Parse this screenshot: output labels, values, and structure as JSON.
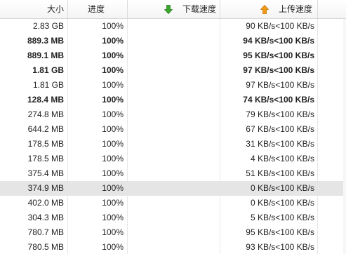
{
  "columns": {
    "size": "大小",
    "progress": "进度",
    "download_speed": "下载速度",
    "upload_speed": "上传速度"
  },
  "rows": [
    {
      "size": "2.83 GB",
      "progress": "100%",
      "down": "",
      "up": "90 KB/s<100 KB/s",
      "bold": false,
      "selected": false
    },
    {
      "size": "889.3 MB",
      "progress": "100%",
      "down": "",
      "up": "94 KB/s<100 KB/s",
      "bold": true,
      "selected": false
    },
    {
      "size": "889.1 MB",
      "progress": "100%",
      "down": "",
      "up": "95 KB/s<100 KB/s",
      "bold": true,
      "selected": false
    },
    {
      "size": "1.81 GB",
      "progress": "100%",
      "down": "",
      "up": "97 KB/s<100 KB/s",
      "bold": true,
      "selected": false
    },
    {
      "size": "1.81 GB",
      "progress": "100%",
      "down": "",
      "up": "97 KB/s<100 KB/s",
      "bold": false,
      "selected": false
    },
    {
      "size": "128.4 MB",
      "progress": "100%",
      "down": "",
      "up": "74 KB/s<100 KB/s",
      "bold": true,
      "selected": false
    },
    {
      "size": "274.8 MB",
      "progress": "100%",
      "down": "",
      "up": "79 KB/s<100 KB/s",
      "bold": false,
      "selected": false
    },
    {
      "size": "644.2 MB",
      "progress": "100%",
      "down": "",
      "up": "67 KB/s<100 KB/s",
      "bold": false,
      "selected": false
    },
    {
      "size": "178.5 MB",
      "progress": "100%",
      "down": "",
      "up": "31 KB/s<100 KB/s",
      "bold": false,
      "selected": false
    },
    {
      "size": "178.5 MB",
      "progress": "100%",
      "down": "",
      "up": "4 KB/s<100 KB/s",
      "bold": false,
      "selected": false
    },
    {
      "size": "375.4 MB",
      "progress": "100%",
      "down": "",
      "up": "51 KB/s<100 KB/s",
      "bold": false,
      "selected": false
    },
    {
      "size": "374.9 MB",
      "progress": "100%",
      "down": "",
      "up": "0 KB/s<100 KB/s",
      "bold": false,
      "selected": true
    },
    {
      "size": "402.0 MB",
      "progress": "100%",
      "down": "",
      "up": "0 KB/s<100 KB/s",
      "bold": false,
      "selected": false
    },
    {
      "size": "304.3 MB",
      "progress": "100%",
      "down": "",
      "up": "5 KB/s<100 KB/s",
      "bold": false,
      "selected": false
    },
    {
      "size": "780.7 MB",
      "progress": "100%",
      "down": "",
      "up": "95 KB/s<100 KB/s",
      "bold": false,
      "selected": false
    },
    {
      "size": "780.5 MB",
      "progress": "100%",
      "down": "",
      "up": "93 KB/s<100 KB/s",
      "bold": false,
      "selected": false
    }
  ],
  "icons": {
    "download": "download-arrow-icon",
    "upload": "upload-arrow-icon"
  },
  "colors": {
    "download_arrow": "#3aa52b",
    "upload_arrow": "#f29a12",
    "selected_row": "#e5e5e5"
  }
}
